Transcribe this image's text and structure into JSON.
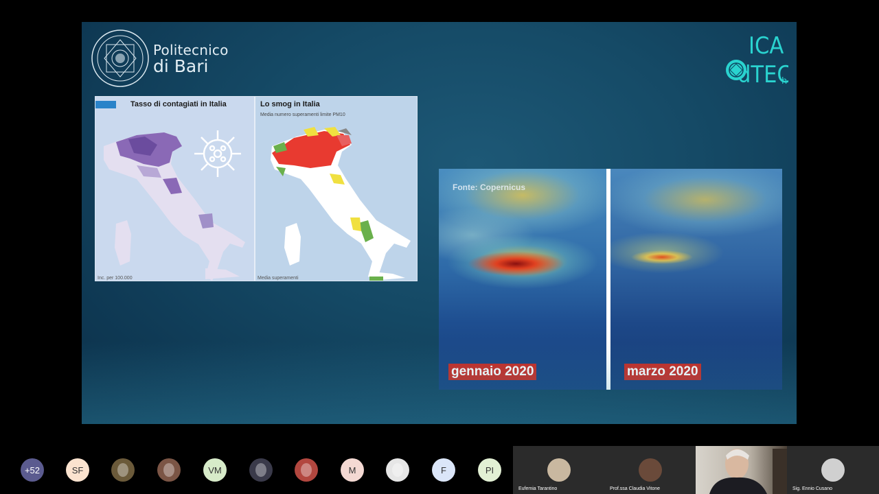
{
  "slide": {
    "institution_line1": "Politecnico",
    "institution_line2": "di Bari",
    "seal_ring_text": "POLITECNICO DI BARI",
    "brand_logo_text": "dICATECh"
  },
  "maps": {
    "left_title": "Tasso di contagiati in Italia",
    "left_footer": "Inc. per 100.000",
    "right_title": "Lo smog in Italia",
    "right_subtitle": "Media numero superamenti limite PM10",
    "right_footer": "Media superamenti"
  },
  "satellite": {
    "source": "Fonte: Copernicus",
    "label_a": "gennaio 2020",
    "label_b": "marzo 2020"
  },
  "participants": {
    "more_count": "+52",
    "chips": [
      {
        "initials": "SF",
        "color": "#fbe3cf"
      },
      {
        "initials": "",
        "color": "#6b5a3a"
      },
      {
        "initials": "",
        "color": "#7b5545"
      },
      {
        "initials": "VM",
        "color": "#d7ebc9"
      },
      {
        "initials": "",
        "color": "#3a3a4a"
      },
      {
        "initials": "",
        "color": "#b2473f"
      },
      {
        "initials": "M",
        "color": "#f4d9d3"
      },
      {
        "initials": "",
        "color": "#e6e6e6"
      },
      {
        "initials": "F",
        "color": "#dbe6f9"
      },
      {
        "initials": "PI",
        "color": "#e2f0d4"
      }
    ],
    "tiles": [
      {
        "name": "Eufemia Tarantino"
      },
      {
        "name": "Prof.ssa Claudia Vitone"
      },
      {
        "name": ""
      },
      {
        "name": "Sig. Ennio Cusano"
      }
    ],
    "more_chip_color": "#5b5b8f"
  }
}
